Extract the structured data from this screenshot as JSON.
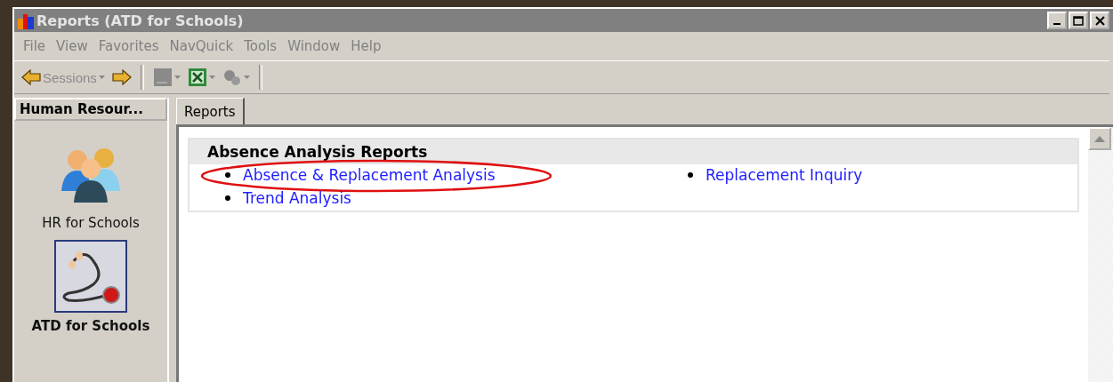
{
  "window": {
    "title": "Reports (ATD for Schools)"
  },
  "menu": [
    "File",
    "View",
    "Favorites",
    "NavQuick",
    "Tools",
    "Window",
    "Help"
  ],
  "toolbar": {
    "sessions": {
      "label": "Sessions",
      "disabled": true
    },
    "tools": [
      {
        "kind": "screen",
        "disabled": true
      },
      {
        "kind": "excel",
        "disabled": false
      },
      {
        "kind": "gears",
        "disabled": true
      }
    ]
  },
  "sidebar": {
    "header": "Human Resour...",
    "items": [
      {
        "label": "HR for Schools",
        "kind": "people",
        "selected": false
      },
      {
        "label": "ATD for Schools",
        "kind": "stethoscope",
        "selected": true
      }
    ]
  },
  "tabs": [
    {
      "label": "Reports",
      "selected": true
    }
  ],
  "section": {
    "title": "Absence Analysis Reports",
    "links": [
      {
        "label": "Absence & Replacement Analysis",
        "highlighted": true
      },
      {
        "label": "Replacement Inquiry",
        "highlighted": false
      },
      {
        "label": "Trend Analysis",
        "highlighted": false
      }
    ]
  }
}
